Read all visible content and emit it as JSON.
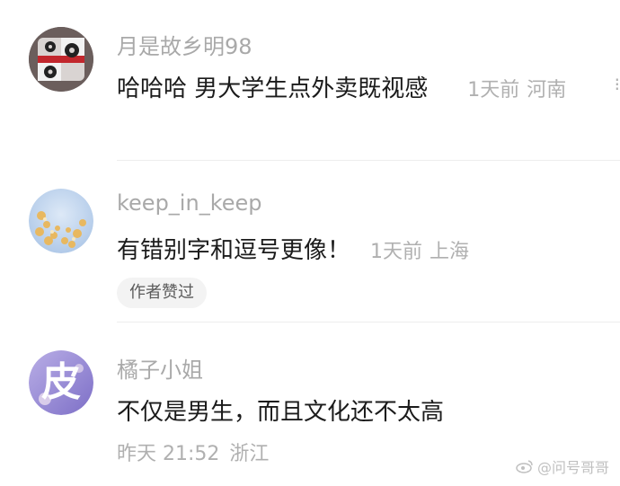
{
  "comments": [
    {
      "username": "月是故乡明98",
      "text": "哈哈哈 男大学生点外卖既视感",
      "time": "1天前",
      "location": "河南",
      "avatar_icon": "gear-badge-avatar"
    },
    {
      "username": "keep_in_keep",
      "text": "有错别字和逗号更像！",
      "time": "1天前",
      "location": "上海",
      "badge": "作者赞过",
      "avatar_icon": "flower-avatar"
    },
    {
      "username": "橘子小姐",
      "text": "不仅是男生，而且文化还不太高",
      "time": "昨天 21:52",
      "location": "浙江",
      "avatar_char": "皮"
    }
  ],
  "watermark": "@问号哥哥",
  "more_glyph": "⁝"
}
